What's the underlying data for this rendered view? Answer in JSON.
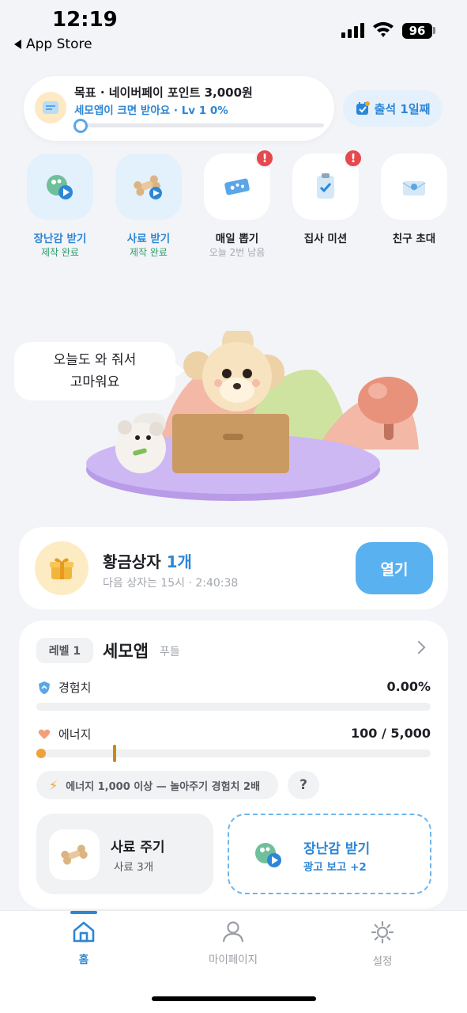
{
  "status_bar": {
    "time": "12:19",
    "back_label": "App Store",
    "battery": "96"
  },
  "goal": {
    "title": "목표 · 네이버페이 포인트 3,000원",
    "subtitle": "세모앱이 크면 받아요 · Lv 1 0%",
    "progress": 0.0
  },
  "attendance": {
    "label": "출석 1일째"
  },
  "quick_actions": [
    {
      "label": "장난감 받기",
      "sub": "제작 완료",
      "sub_color": "#2f9e6e",
      "label_color": "#2d86d6",
      "icon": "toy-ball-icon",
      "alert": false
    },
    {
      "label": "사료 받기",
      "sub": "제작 완료",
      "sub_color": "#2f9e6e",
      "label_color": "#2d86d6",
      "icon": "bone-icon",
      "alert": false
    },
    {
      "label": "매일 뽑기",
      "sub": "오늘 2번 남음",
      "sub_color": "#a3a7ae",
      "label_color": "#1d1f24",
      "icon": "ticket-icon",
      "alert": true
    },
    {
      "label": "집사 미션",
      "sub": "",
      "sub_color": "#a3a7ae",
      "label_color": "#1d1f24",
      "icon": "clipboard-check-icon",
      "alert": true
    },
    {
      "label": "친구 초대",
      "sub": "",
      "sub_color": "#a3a7ae",
      "label_color": "#1d1f24",
      "icon": "envelope-icon",
      "alert": false
    }
  ],
  "alert_mark": "!",
  "scene": {
    "bubble_line1": "오늘도 와 줘서",
    "bubble_line2": "고마워요"
  },
  "golden_box": {
    "title": "황금상자",
    "count": "1개",
    "next": "다음 상자는 15시 · 2:40:38",
    "open_label": "열기"
  },
  "pet": {
    "level_chip": "레벨 1",
    "name": "세모앱",
    "breed": "푸들",
    "exp_label": "경험치",
    "exp_value": "0.00%",
    "exp_progress": 0.0,
    "energy_label": "에너지",
    "energy_value": "100 / 5,000",
    "energy_progress": 0.02,
    "tip": "에너지 1,000 이상 — 놀아주기 경험치 2배",
    "help": "?",
    "feed_title": "사료 주기",
    "feed_sub": "사료 3개",
    "toy_title": "장난감 받기",
    "toy_sub": "광고 보고 +2"
  },
  "tabs": [
    {
      "label": "홈",
      "icon": "home-icon",
      "active": true
    },
    {
      "label": "마이페이지",
      "icon": "person-icon",
      "active": false
    },
    {
      "label": "설정",
      "icon": "sun-gear-icon",
      "active": false
    }
  ],
  "colors": {
    "accent": "#2d86d6",
    "button": "#5ab1f0",
    "alert": "#e5484d",
    "energy": "#f0a23a"
  }
}
